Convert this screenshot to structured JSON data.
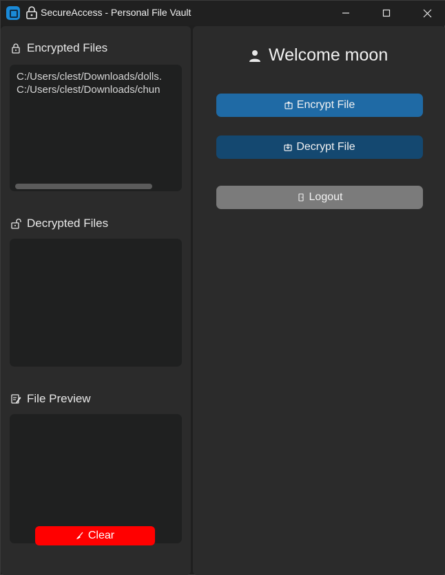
{
  "window": {
    "title": "SecureAccess - Personal File Vault"
  },
  "left": {
    "encrypted": {
      "title": "Encrypted Files",
      "files": [
        "C:/Users/clest/Downloads/dolls.",
        "C:/Users/clest/Downloads/chun"
      ]
    },
    "decrypted": {
      "title": "Decrypted Files",
      "files": []
    },
    "preview": {
      "title": "File Preview",
      "content": ""
    },
    "clear_label": "Clear"
  },
  "right": {
    "welcome": "Welcome moon",
    "encrypt_label": "Encrypt File",
    "decrypt_label": "Decrypt File",
    "logout_label": "Logout"
  },
  "colors": {
    "encrypt": "#1f6aa5",
    "decrypt": "#144870",
    "logout": "#7b7b7b",
    "clear": "#ff0000"
  }
}
